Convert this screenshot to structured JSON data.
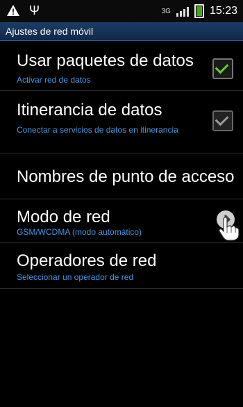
{
  "status_bar": {
    "time": "15:23",
    "network_type": "3G",
    "icons": [
      "warning-icon",
      "usb-icon",
      "signal-icon",
      "battery-icon"
    ],
    "battery_color": "#46a81f"
  },
  "header": {
    "title": "Ajustes de red móvil"
  },
  "settings": {
    "items": [
      {
        "label": "Usar paquetes de datos",
        "summary": "Activar red de datos",
        "control": "checkbox",
        "checked": true
      },
      {
        "label": "Itinerancia de datos",
        "summary": "Conectar a servicios de datos en itinerancia",
        "control": "checkbox",
        "checked": true
      },
      {
        "label": "Nombres de punto de acceso",
        "summary": "",
        "control": "none"
      },
      {
        "label": "Modo de red",
        "summary": "GSM/WCDMA (modo automático)",
        "control": "chevron",
        "tap_hand_icon": true
      },
      {
        "label": "Operadores de red",
        "summary": "Seleccionar un operador de red",
        "control": "none"
      }
    ]
  },
  "colors": {
    "accent_text": "#3d9ae4",
    "titlebar_bg": "#1d3d67",
    "check_green": "#62d41f"
  }
}
